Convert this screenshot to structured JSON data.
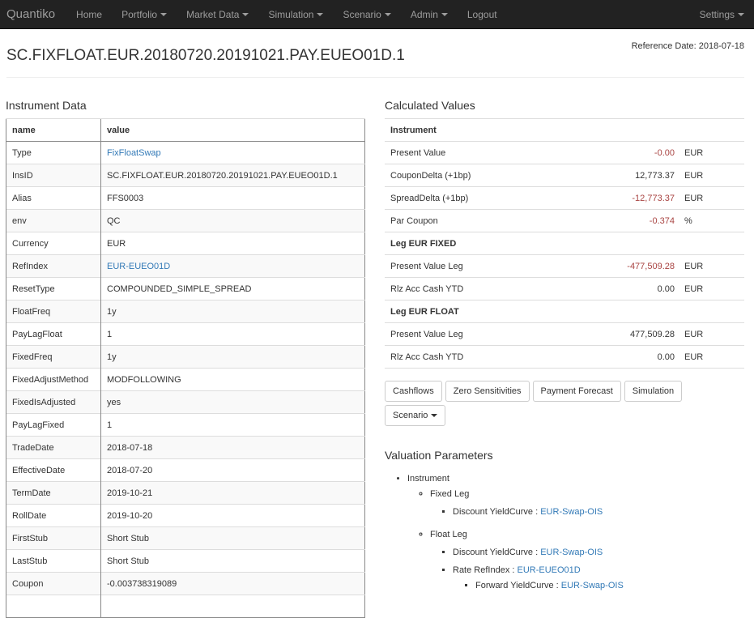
{
  "nav": {
    "brand": "Quantiko",
    "items": [
      {
        "label": "Home",
        "dropdown": false
      },
      {
        "label": "Portfolio",
        "dropdown": true
      },
      {
        "label": "Market Data",
        "dropdown": true
      },
      {
        "label": "Simulation",
        "dropdown": true
      },
      {
        "label": "Scenario",
        "dropdown": true
      },
      {
        "label": "Admin",
        "dropdown": true
      },
      {
        "label": "Logout",
        "dropdown": false
      }
    ],
    "settings": "Settings"
  },
  "header": {
    "title": "SC.FIXFLOAT.EUR.20180720.20191021.PAY.EUEO01D.1",
    "reference_date": "Reference Date: 2018-07-18"
  },
  "instrument": {
    "section_title": "Instrument Data",
    "columns": [
      "name",
      "value"
    ],
    "rows": [
      {
        "name": "Type",
        "value": "FixFloatSwap",
        "link": true
      },
      {
        "name": "InsID",
        "value": "SC.FIXFLOAT.EUR.20180720.20191021.PAY.EUEO01D.1",
        "link": false
      },
      {
        "name": "Alias",
        "value": "FFS0003",
        "link": false
      },
      {
        "name": "env",
        "value": "QC",
        "link": false
      },
      {
        "name": "Currency",
        "value": "EUR",
        "link": false
      },
      {
        "name": "RefIndex",
        "value": "EUR-EUEO01D",
        "link": true
      },
      {
        "name": "ResetType",
        "value": "COMPOUNDED_SIMPLE_SPREAD",
        "link": false
      },
      {
        "name": "FloatFreq",
        "value": "1y",
        "link": false
      },
      {
        "name": "PayLagFloat",
        "value": "1",
        "link": false
      },
      {
        "name": "FixedFreq",
        "value": "1y",
        "link": false
      },
      {
        "name": "FixedAdjustMethod",
        "value": "MODFOLLOWING",
        "link": false
      },
      {
        "name": "FixedIsAdjusted",
        "value": "yes",
        "link": false
      },
      {
        "name": "PayLagFixed",
        "value": "1",
        "link": false
      },
      {
        "name": "TradeDate",
        "value": "2018-07-18",
        "link": false
      },
      {
        "name": "EffectiveDate",
        "value": "2018-07-20",
        "link": false
      },
      {
        "name": "TermDate",
        "value": "2019-10-21",
        "link": false
      },
      {
        "name": "RollDate",
        "value": "2019-10-20",
        "link": false
      },
      {
        "name": "FirstStub",
        "value": "Short Stub",
        "link": false
      },
      {
        "name": "LastStub",
        "value": "Short Stub",
        "link": false
      },
      {
        "name": "Coupon",
        "value": "-0.003738319089",
        "link": false
      },
      {
        "name": "",
        "value": "",
        "link": false
      }
    ]
  },
  "calculated": {
    "section_title": "Calculated Values",
    "rows": [
      {
        "header": "Instrument"
      },
      {
        "label": "Present Value",
        "value": "-0.00",
        "unit": "EUR",
        "negative": true
      },
      {
        "label": "CouponDelta (+1bp)",
        "value": "12,773.37",
        "unit": "EUR",
        "negative": false
      },
      {
        "label": "SpreadDelta (+1bp)",
        "value": "-12,773.37",
        "unit": "EUR",
        "negative": true
      },
      {
        "label": "Par Coupon",
        "value": "-0.374",
        "unit": "%",
        "negative": true
      },
      {
        "header": "Leg EUR FIXED"
      },
      {
        "label": "Present Value Leg",
        "value": "-477,509.28",
        "unit": "EUR",
        "negative": true
      },
      {
        "label": "Rlz Acc Cash YTD",
        "value": "0.00",
        "unit": "EUR",
        "negative": false
      },
      {
        "header": "Leg EUR FLOAT"
      },
      {
        "label": "Present Value Leg",
        "value": "477,509.28",
        "unit": "EUR",
        "negative": false
      },
      {
        "label": "Rlz Acc Cash YTD",
        "value": "0.00",
        "unit": "EUR",
        "negative": false
      }
    ]
  },
  "buttons": [
    {
      "label": "Cashflows",
      "dropdown": false
    },
    {
      "label": "Zero Sensitivities",
      "dropdown": false
    },
    {
      "label": "Payment Forecast",
      "dropdown": false
    },
    {
      "label": "Simulation",
      "dropdown": false
    },
    {
      "label": "Scenario",
      "dropdown": true
    }
  ],
  "valuation": {
    "section_title": "Valuation Parameters",
    "instrument_label": "Instrument",
    "fixed_leg": {
      "label": "Fixed Leg",
      "discount_label": "Discount YieldCurve : ",
      "discount_value": "EUR-Swap-OIS"
    },
    "float_leg": {
      "label": "Float Leg",
      "discount_label": "Discount YieldCurve : ",
      "discount_value": "EUR-Swap-OIS",
      "rate_label": "Rate RefIndex : ",
      "rate_value": "EUR-EUEO01D",
      "forward_label": "Forward YieldCurve : ",
      "forward_value": "EUR-Swap-OIS"
    }
  },
  "colors": {
    "navbar_bg": "#222222",
    "link": "#337ab7",
    "negative": "#a94442"
  }
}
